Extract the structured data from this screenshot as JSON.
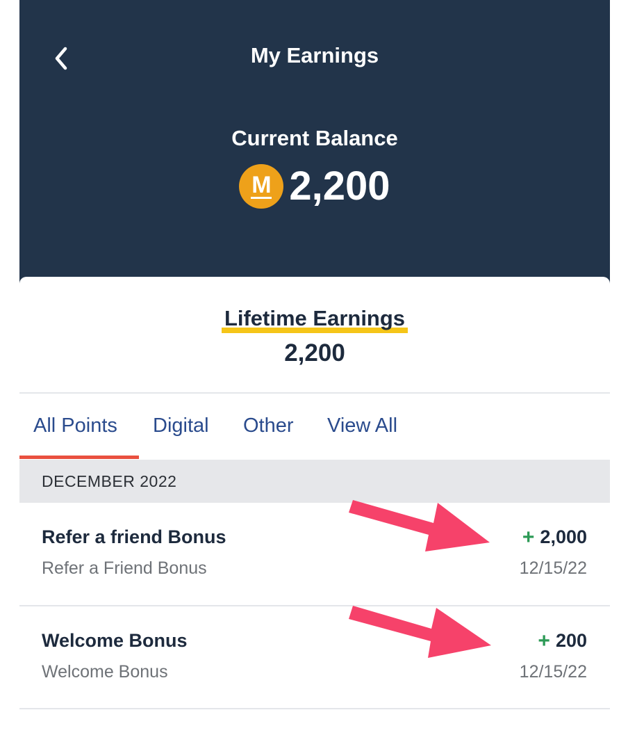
{
  "header": {
    "title": "My Earnings",
    "balance_label": "Current Balance",
    "coin_letter": "M",
    "balance_value": "2,200"
  },
  "lifetime": {
    "label": "Lifetime Earnings",
    "value": "2,200"
  },
  "tabs": [
    {
      "label": "All Points",
      "selected": true
    },
    {
      "label": "Digital",
      "selected": false
    },
    {
      "label": "Other",
      "selected": false
    },
    {
      "label": "View All",
      "selected": false
    }
  ],
  "section": {
    "title": "DECEMBER 2022"
  },
  "transactions": [
    {
      "title": "Refer a friend Bonus",
      "subtitle": "Refer a Friend Bonus",
      "sign": "+",
      "amount": "2,000",
      "date": "12/15/22"
    },
    {
      "title": "Welcome Bonus",
      "subtitle": "Welcome Bonus",
      "sign": "+",
      "amount": "200",
      "date": "12/15/22"
    }
  ],
  "colors": {
    "header_bg": "#22344a",
    "coin": "#eea11a",
    "highlight": "#f5c518",
    "tab_text": "#2a4b8d",
    "tab_indicator": "#e9503f",
    "positive": "#2c9a56",
    "annotation_arrow": "#f6426a"
  },
  "icons": {
    "back": "chevron-left-icon",
    "coin": "m-coin-icon",
    "annotation": "pink-arrow-icon"
  }
}
